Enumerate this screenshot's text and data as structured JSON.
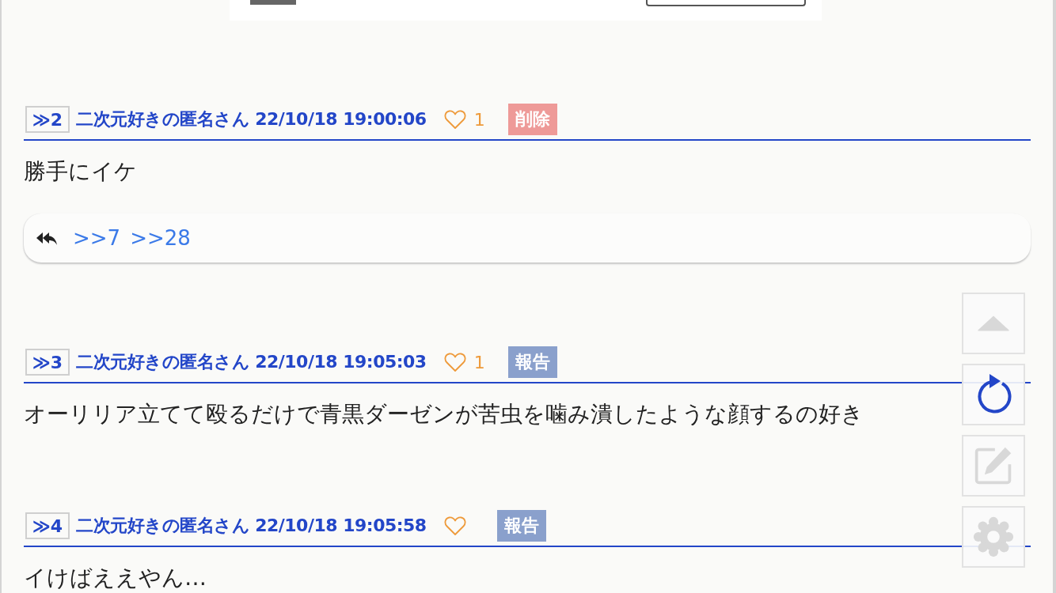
{
  "posts": [
    {
      "number": "≫2",
      "author": "二次元好きの匿名さん",
      "date": "22/10/18 19:00:06",
      "likes": "1",
      "action": {
        "kind": "delete",
        "label": "削除"
      },
      "body": "勝手にイケ",
      "replies": [
        ">>7",
        ">>28"
      ]
    },
    {
      "number": "≫3",
      "author": "二次元好きの匿名さん",
      "date": "22/10/18 19:05:03",
      "likes": "1",
      "action": {
        "kind": "report",
        "label": "報告"
      },
      "body": "オーリリア立てて殴るだけで青黒ダーゼンが苦虫を噛み潰したような顔するの好き"
    },
    {
      "number": "≫4",
      "author": "二次元好きの匿名さん",
      "date": "22/10/18 19:05:58",
      "action": {
        "kind": "report",
        "label": "報告"
      },
      "body": "イけばええやん…"
    }
  ]
}
